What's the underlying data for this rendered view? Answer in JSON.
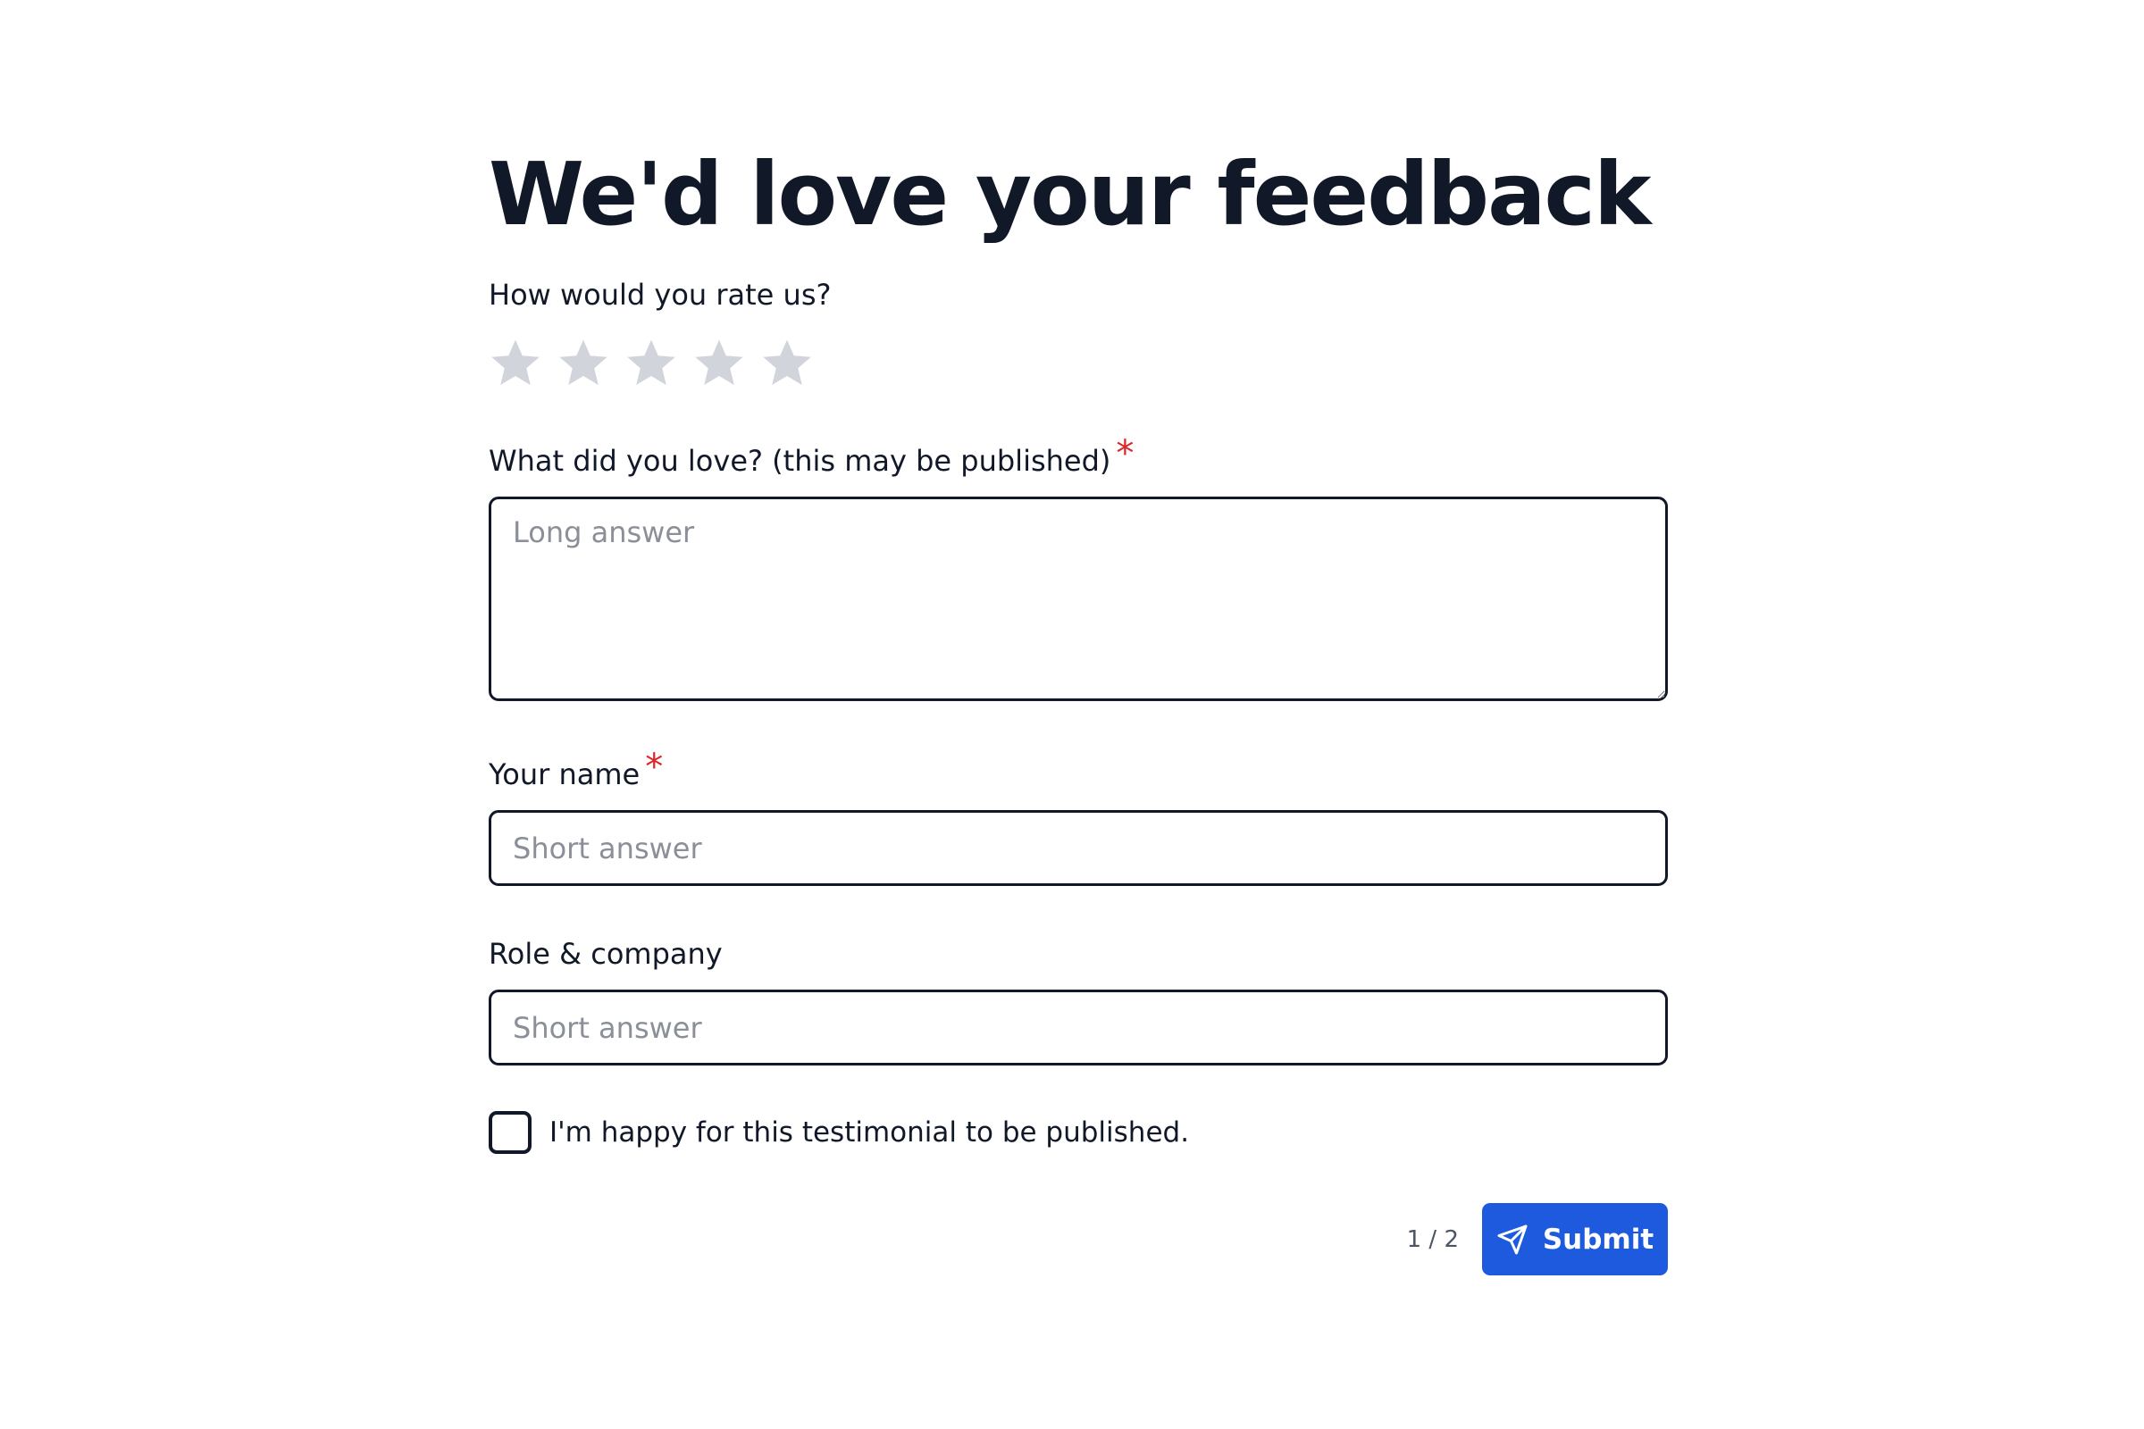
{
  "form": {
    "title": "We'd love your feedback",
    "rating": {
      "label": "How would you rate us?",
      "max": 5,
      "value": 0,
      "empty_color": "#d1d5db",
      "icon": "star-icon"
    },
    "love": {
      "label": "What did you love? (this may be published)",
      "required_mark": "*",
      "placeholder": "Long answer",
      "value": ""
    },
    "name": {
      "label": "Your name",
      "required_mark": "*",
      "placeholder": "Short answer",
      "value": ""
    },
    "role": {
      "label": "Role & company",
      "placeholder": "Short answer",
      "value": ""
    },
    "consent": {
      "label": "I'm happy for this testimonial to be published.",
      "checked": false
    },
    "footer": {
      "page_indicator": "1 / 2",
      "submit_label": "Submit",
      "submit_icon": "send-icon"
    }
  },
  "colors": {
    "text": "#111827",
    "required": "#dc2626",
    "accent": "#1d5ade",
    "placeholder": "#8a8f98",
    "border": "#111827"
  }
}
